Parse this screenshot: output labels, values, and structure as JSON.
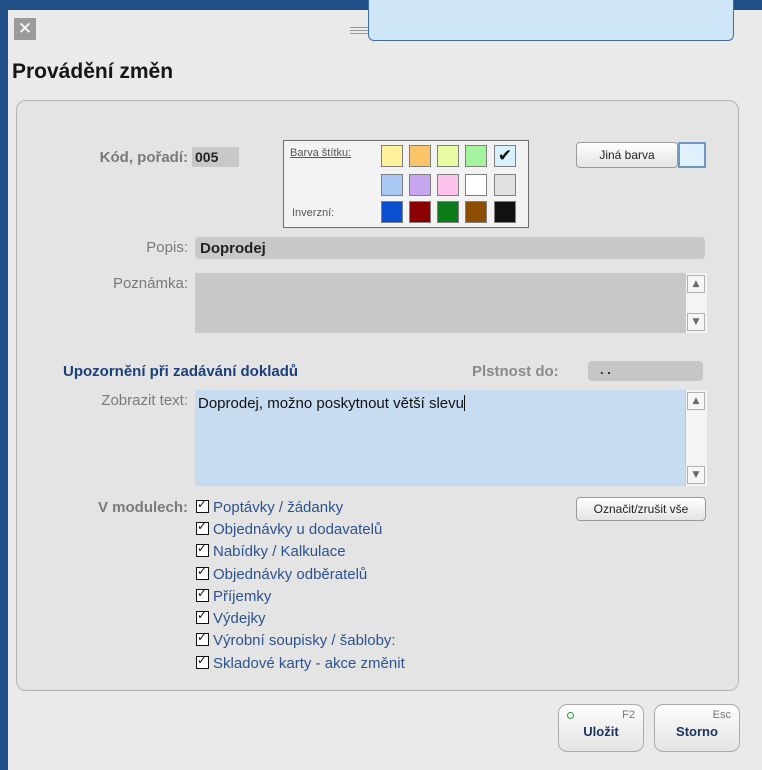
{
  "dialog": {
    "title": "Provádění změn"
  },
  "icons": {
    "close": "close-icon",
    "checkmark": "checkmark-icon"
  },
  "colors": {
    "title_blue": "#1b3f7a",
    "module_blue": "#2c538e",
    "textarea_bg": "#c8dcf1"
  },
  "labels": {
    "code": "Kód, pořadí:",
    "popis": "Popis:",
    "poznamka": "Poznámka:",
    "plstnost": "Plstnost do:",
    "zobrazit": "Zobrazit text:",
    "moduly": "V modulech:"
  },
  "fields": {
    "code": "005",
    "popis": "Doprodej",
    "poznamka": "",
    "plstnost": ". .",
    "zobrazit_text": "Doprodej, možno poskytnout větší slevu"
  },
  "label_color": {
    "title": "Barva štítku:",
    "inverse_label": "Inverzní:",
    "selected": "#ececec",
    "palette_row1": [
      "#fff29a",
      "#fbc56a",
      "#e8fba0",
      "#a6f39e",
      "#d6f1fb"
    ],
    "palette_row2": [
      "#a9c8f4",
      "#c6a6ee",
      "#fbc2ec",
      "#ffffff",
      "#e0e0e0"
    ],
    "palette_row3": [
      "#0a4fd0",
      "#8a0000",
      "#0b7a18",
      "#8e4c00",
      "#111111"
    ]
  },
  "buttons": {
    "other_color": "Jiná barva",
    "toggle_all": "Označit/zrušit vše",
    "save": "Uložit",
    "save_key": "F2",
    "cancel": "Storno",
    "cancel_key": "Esc"
  },
  "section": {
    "title": "Upozornění při zadávání dokladů"
  },
  "modules": [
    {
      "label": "Poptávky / žádanky",
      "checked": true
    },
    {
      "label": "Objednávky u dodavatelů",
      "checked": true
    },
    {
      "label": "Nabídky / Kalkulace",
      "checked": true
    },
    {
      "label": "Objednávky odběratelů",
      "checked": true
    },
    {
      "label": "Příjemky",
      "checked": true
    },
    {
      "label": "Výdejky",
      "checked": true
    },
    {
      "label": "Výrobní soupisky / šabloby:",
      "checked": true
    },
    {
      "label": "Skladové karty - akce změnit",
      "checked": true
    }
  ]
}
